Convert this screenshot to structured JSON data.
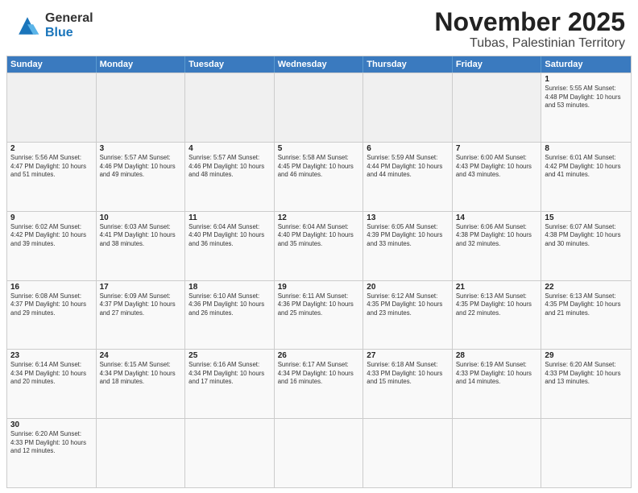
{
  "logo": {
    "general": "General",
    "blue": "Blue"
  },
  "title": "November 2025",
  "subtitle": "Tubas, Palestinian Territory",
  "days": [
    "Sunday",
    "Monday",
    "Tuesday",
    "Wednesday",
    "Thursday",
    "Friday",
    "Saturday"
  ],
  "week0": [
    {
      "day": "",
      "info": ""
    },
    {
      "day": "",
      "info": ""
    },
    {
      "day": "",
      "info": ""
    },
    {
      "day": "",
      "info": ""
    },
    {
      "day": "",
      "info": ""
    },
    {
      "day": "",
      "info": ""
    },
    {
      "day": "1",
      "info": "Sunrise: 5:55 AM\nSunset: 4:48 PM\nDaylight: 10 hours\nand 53 minutes."
    }
  ],
  "week1": [
    {
      "day": "2",
      "info": "Sunrise: 5:56 AM\nSunset: 4:47 PM\nDaylight: 10 hours\nand 51 minutes."
    },
    {
      "day": "3",
      "info": "Sunrise: 5:57 AM\nSunset: 4:46 PM\nDaylight: 10 hours\nand 49 minutes."
    },
    {
      "day": "4",
      "info": "Sunrise: 5:57 AM\nSunset: 4:46 PM\nDaylight: 10 hours\nand 48 minutes."
    },
    {
      "day": "5",
      "info": "Sunrise: 5:58 AM\nSunset: 4:45 PM\nDaylight: 10 hours\nand 46 minutes."
    },
    {
      "day": "6",
      "info": "Sunrise: 5:59 AM\nSunset: 4:44 PM\nDaylight: 10 hours\nand 44 minutes."
    },
    {
      "day": "7",
      "info": "Sunrise: 6:00 AM\nSunset: 4:43 PM\nDaylight: 10 hours\nand 43 minutes."
    },
    {
      "day": "8",
      "info": "Sunrise: 6:01 AM\nSunset: 4:42 PM\nDaylight: 10 hours\nand 41 minutes."
    }
  ],
  "week2": [
    {
      "day": "9",
      "info": "Sunrise: 6:02 AM\nSunset: 4:42 PM\nDaylight: 10 hours\nand 39 minutes."
    },
    {
      "day": "10",
      "info": "Sunrise: 6:03 AM\nSunset: 4:41 PM\nDaylight: 10 hours\nand 38 minutes."
    },
    {
      "day": "11",
      "info": "Sunrise: 6:04 AM\nSunset: 4:40 PM\nDaylight: 10 hours\nand 36 minutes."
    },
    {
      "day": "12",
      "info": "Sunrise: 6:04 AM\nSunset: 4:40 PM\nDaylight: 10 hours\nand 35 minutes."
    },
    {
      "day": "13",
      "info": "Sunrise: 6:05 AM\nSunset: 4:39 PM\nDaylight: 10 hours\nand 33 minutes."
    },
    {
      "day": "14",
      "info": "Sunrise: 6:06 AM\nSunset: 4:38 PM\nDaylight: 10 hours\nand 32 minutes."
    },
    {
      "day": "15",
      "info": "Sunrise: 6:07 AM\nSunset: 4:38 PM\nDaylight: 10 hours\nand 30 minutes."
    }
  ],
  "week3": [
    {
      "day": "16",
      "info": "Sunrise: 6:08 AM\nSunset: 4:37 PM\nDaylight: 10 hours\nand 29 minutes."
    },
    {
      "day": "17",
      "info": "Sunrise: 6:09 AM\nSunset: 4:37 PM\nDaylight: 10 hours\nand 27 minutes."
    },
    {
      "day": "18",
      "info": "Sunrise: 6:10 AM\nSunset: 4:36 PM\nDaylight: 10 hours\nand 26 minutes."
    },
    {
      "day": "19",
      "info": "Sunrise: 6:11 AM\nSunset: 4:36 PM\nDaylight: 10 hours\nand 25 minutes."
    },
    {
      "day": "20",
      "info": "Sunrise: 6:12 AM\nSunset: 4:35 PM\nDaylight: 10 hours\nand 23 minutes."
    },
    {
      "day": "21",
      "info": "Sunrise: 6:13 AM\nSunset: 4:35 PM\nDaylight: 10 hours\nand 22 minutes."
    },
    {
      "day": "22",
      "info": "Sunrise: 6:13 AM\nSunset: 4:35 PM\nDaylight: 10 hours\nand 21 minutes."
    }
  ],
  "week4": [
    {
      "day": "23",
      "info": "Sunrise: 6:14 AM\nSunset: 4:34 PM\nDaylight: 10 hours\nand 20 minutes."
    },
    {
      "day": "24",
      "info": "Sunrise: 6:15 AM\nSunset: 4:34 PM\nDaylight: 10 hours\nand 18 minutes."
    },
    {
      "day": "25",
      "info": "Sunrise: 6:16 AM\nSunset: 4:34 PM\nDaylight: 10 hours\nand 17 minutes."
    },
    {
      "day": "26",
      "info": "Sunrise: 6:17 AM\nSunset: 4:34 PM\nDaylight: 10 hours\nand 16 minutes."
    },
    {
      "day": "27",
      "info": "Sunrise: 6:18 AM\nSunset: 4:33 PM\nDaylight: 10 hours\nand 15 minutes."
    },
    {
      "day": "28",
      "info": "Sunrise: 6:19 AM\nSunset: 4:33 PM\nDaylight: 10 hours\nand 14 minutes."
    },
    {
      "day": "29",
      "info": "Sunrise: 6:20 AM\nSunset: 4:33 PM\nDaylight: 10 hours\nand 13 minutes."
    }
  ],
  "week5": [
    {
      "day": "30",
      "info": "Sunrise: 6:20 AM\nSunset: 4:33 PM\nDaylight: 10 hours\nand 12 minutes."
    },
    {
      "day": "",
      "info": ""
    },
    {
      "day": "",
      "info": ""
    },
    {
      "day": "",
      "info": ""
    },
    {
      "day": "",
      "info": ""
    },
    {
      "day": "",
      "info": ""
    },
    {
      "day": "",
      "info": ""
    }
  ]
}
